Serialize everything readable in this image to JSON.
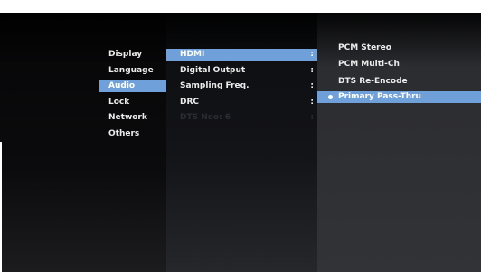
{
  "menu": {
    "categories": [
      {
        "label": "Display"
      },
      {
        "label": "Language"
      },
      {
        "label": "Audio"
      },
      {
        "label": "Lock"
      },
      {
        "label": "Network"
      },
      {
        "label": "Others"
      }
    ],
    "selected_category": "Audio"
  },
  "audio_settings": [
    {
      "label": "HDMI",
      "separator": ":"
    },
    {
      "label": "Digital Output",
      "separator": ":"
    },
    {
      "label": "Sampling Freq.",
      "separator": ":"
    },
    {
      "label": "DRC",
      "separator": ":"
    },
    {
      "label": "DTS Neo: 6",
      "separator": ":"
    }
  ],
  "selected_setting": "HDMI",
  "hdmi_options": [
    {
      "label": "PCM Stereo"
    },
    {
      "label": "PCM Multi-Ch"
    },
    {
      "label": "DTS Re-Encode"
    },
    {
      "label": "Primary Pass-Thru"
    }
  ],
  "selected_option": "Primary Pass-Thru",
  "colors": {
    "highlight": "#6fa0d9",
    "background": "#050506",
    "text": "#ececec"
  }
}
